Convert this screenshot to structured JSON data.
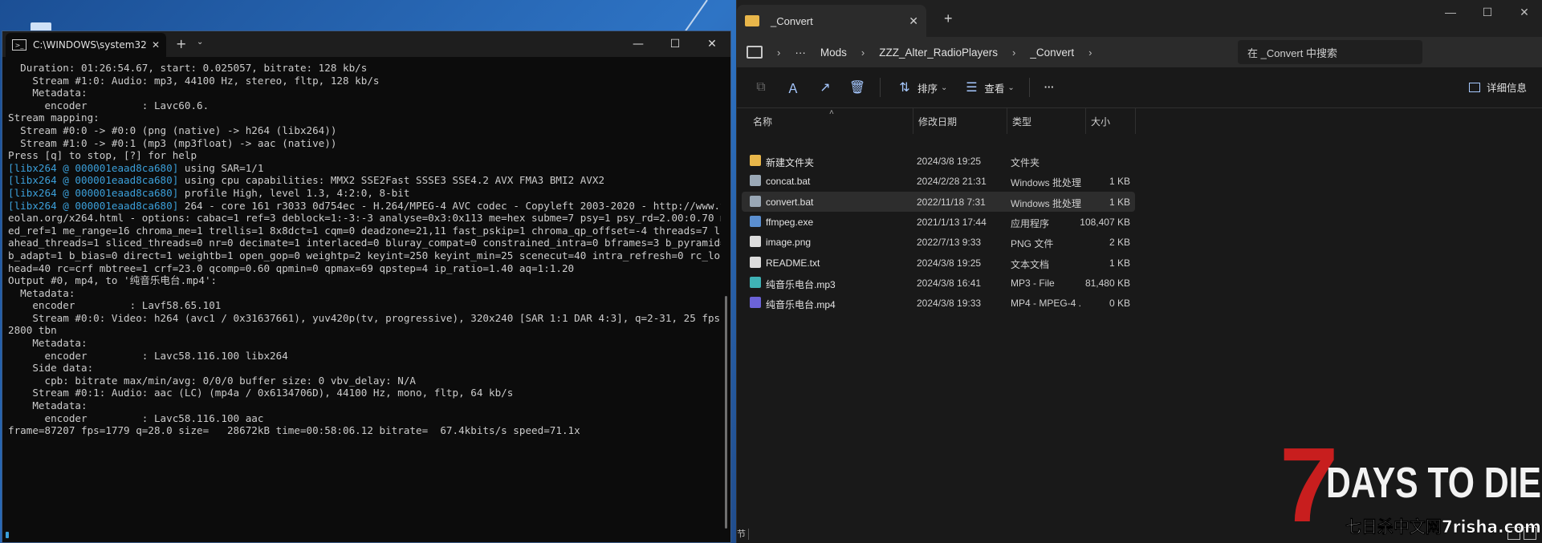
{
  "explorer": {
    "tab_title": "_Convert",
    "breadcrumb": [
      "Mods",
      "ZZZ_Alter_RadioPlayers",
      "_Convert"
    ],
    "search_placeholder": "在 _Convert 中搜索",
    "toolbar": {
      "sort_label": "排序",
      "view_label": "查看",
      "more_label": "···",
      "details_label": "详细信息"
    },
    "columns": {
      "name": "名称",
      "date": "修改日期",
      "type": "类型",
      "size": "大小"
    },
    "files": [
      {
        "name": "新建文件夹",
        "date": "2024/3/8 19:25",
        "type": "文件夹",
        "size": "",
        "icon": "folder-icon",
        "color": "#e8b64a"
      },
      {
        "name": "concat.bat",
        "date": "2024/2/28 21:31",
        "type": "Windows 批处理...",
        "size": "1 KB",
        "icon": "bat-file-icon",
        "color": "#9aa8b6"
      },
      {
        "name": "convert.bat",
        "date": "2022/11/18 7:31",
        "type": "Windows 批处理...",
        "size": "1 KB",
        "icon": "bat-file-icon",
        "color": "#9aa8b6"
      },
      {
        "name": "ffmpeg.exe",
        "date": "2021/1/13 17:44",
        "type": "应用程序",
        "size": "108,407 KB",
        "icon": "exe-file-icon",
        "color": "#5b8fd0"
      },
      {
        "name": "image.png",
        "date": "2022/7/13 9:33",
        "type": "PNG 文件",
        "size": "2 KB",
        "icon": "image-file-icon",
        "color": "#dcdcdc"
      },
      {
        "name": "README.txt",
        "date": "2024/3/8 19:25",
        "type": "文本文档",
        "size": "1 KB",
        "icon": "text-file-icon",
        "color": "#dcdcdc"
      },
      {
        "name": "纯音乐电台.mp3",
        "date": "2024/3/8 16:41",
        "type": "MP3 - File",
        "size": "81,480 KB",
        "icon": "mp3-file-icon",
        "color": "#3fb2b5"
      },
      {
        "name": "纯音乐电台.mp4",
        "date": "2024/3/8 19:33",
        "type": "MP4 - MPEG-4 ...",
        "size": "0 KB",
        "icon": "mp4-file-icon",
        "color": "#6c63d8"
      }
    ],
    "selected_index": 2,
    "status_left": "节"
  },
  "terminal": {
    "tab_title": "C:\\WINDOWS\\system32\\cmd.",
    "lines": [
      {
        "tag": "",
        "text": "  Duration: 01:26:54.67, start: 0.025057, bitrate: 128 kb/s"
      },
      {
        "tag": "",
        "text": "    Stream #1:0: Audio: mp3, 44100 Hz, stereo, fltp, 128 kb/s"
      },
      {
        "tag": "",
        "text": "    Metadata:"
      },
      {
        "tag": "",
        "text": "      encoder         : Lavc60.6."
      },
      {
        "tag": "",
        "text": "Stream mapping:"
      },
      {
        "tag": "",
        "text": "  Stream #0:0 -> #0:0 (png (native) -> h264 (libx264))"
      },
      {
        "tag": "",
        "text": "  Stream #1:0 -> #0:1 (mp3 (mp3float) -> aac (native))"
      },
      {
        "tag": "",
        "text": "Press [q] to stop, [?] for help"
      },
      {
        "tag": "[libx264 @ 000001eaad8ca680]",
        "text": " using SAR=1/1"
      },
      {
        "tag": "[libx264 @ 000001eaad8ca680]",
        "text": " using cpu capabilities: MMX2 SSE2Fast SSSE3 SSE4.2 AVX FMA3 BMI2 AVX2"
      },
      {
        "tag": "[libx264 @ 000001eaad8ca680]",
        "text": " profile High, level 1.3, 4:2:0, 8-bit"
      },
      {
        "tag": "[libx264 @ 000001eaad8ca680]",
        "text": " 264 - core 161 r3033 0d754ec - H.264/MPEG-4 AVC codec - Copyleft 2003-2020 - http://www.vid"
      },
      {
        "tag": "",
        "text": "eolan.org/x264.html - options: cabac=1 ref=3 deblock=1:-3:-3 analyse=0x3:0x113 me=hex subme=7 psy=1 psy_rd=2.00:0.70 mix"
      },
      {
        "tag": "",
        "text": "ed_ref=1 me_range=16 chroma_me=1 trellis=1 8x8dct=1 cqm=0 deadzone=21,11 fast_pskip=1 chroma_qp_offset=-4 threads=7 look"
      },
      {
        "tag": "",
        "text": "ahead_threads=1 sliced_threads=0 nr=0 decimate=1 interlaced=0 bluray_compat=0 constrained_intra=0 bframes=3 b_pyramid=2"
      },
      {
        "tag": "",
        "text": "b_adapt=1 b_bias=0 direct=1 weightb=1 open_gop=0 weightp=2 keyint=250 keyint_min=25 scenecut=40 intra_refresh=0 rc_looka"
      },
      {
        "tag": "",
        "text": "head=40 rc=crf mbtree=1 crf=23.0 qcomp=0.60 qpmin=0 qpmax=69 qpstep=4 ip_ratio=1.40 aq=1:1.20"
      },
      {
        "tag": "",
        "text": "Output #0, mp4, to '纯音乐电台.mp4':"
      },
      {
        "tag": "",
        "text": "  Metadata:"
      },
      {
        "tag": "",
        "text": "    encoder         : Lavf58.65.101"
      },
      {
        "tag": "",
        "text": "    Stream #0:0: Video: h264 (avc1 / 0x31637661), yuv420p(tv, progressive), 320x240 [SAR 1:1 DAR 4:3], q=2-31, 25 fps, 1"
      },
      {
        "tag": "",
        "text": "2800 tbn"
      },
      {
        "tag": "",
        "text": "    Metadata:"
      },
      {
        "tag": "",
        "text": "      encoder         : Lavc58.116.100 libx264"
      },
      {
        "tag": "",
        "text": "    Side data:"
      },
      {
        "tag": "",
        "text": "      cpb: bitrate max/min/avg: 0/0/0 buffer size: 0 vbv_delay: N/A"
      },
      {
        "tag": "",
        "text": "    Stream #0:1: Audio: aac (LC) (mp4a / 0x6134706D), 44100 Hz, mono, fltp, 64 kb/s"
      },
      {
        "tag": "",
        "text": "    Metadata:"
      },
      {
        "tag": "",
        "text": "      encoder         : Lavc58.116.100 aac"
      },
      {
        "tag": "",
        "text": "frame=87207 fps=1779 q=28.0 size=   28672kB time=00:58:06.12 bitrate=  67.4kbits/s speed=71.1x"
      }
    ]
  },
  "logo": {
    "big_digit": "7",
    "main": "DAYS TO DIE",
    "sub": "七日杀中文网7risha.com"
  }
}
